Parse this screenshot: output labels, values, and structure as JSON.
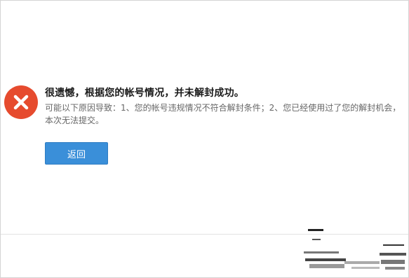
{
  "error": {
    "title": "很遗憾，根据您的帐号情况，并未解封成功。",
    "message": "可能以下原因导致：1、您的帐号违规情况不符合解封条件；2、您已经使用过了您的解封机会，本次无法提交。",
    "icon": "close-icon",
    "icon_color": "#e64b2e"
  },
  "actions": {
    "back_label": "返回",
    "back_color": "#3a8fd9"
  }
}
